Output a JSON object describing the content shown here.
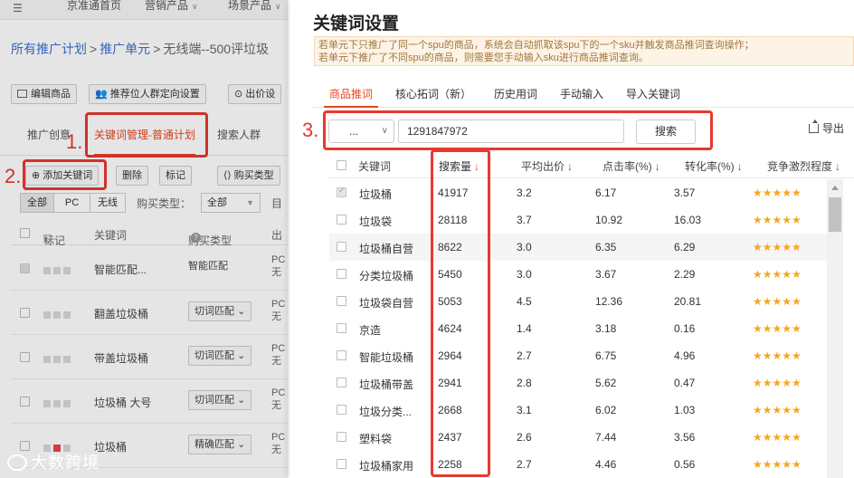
{
  "background": {
    "topnav": {
      "menu_icon": "menu-icon",
      "items": [
        "京准通首页",
        "营销产品",
        "场景产品"
      ]
    },
    "breadcrumb": {
      "part1": "所有推广计划",
      "part2": "推广单元",
      "part3": "无线端--500评垃圾"
    },
    "toolbar1": {
      "edit_goods": "编辑商品",
      "recommend_crowd": "推荐位人群定向设置",
      "bid": "出价设"
    },
    "tabs": {
      "creative": "推广创意",
      "keywords": "关键词管理-普通计划",
      "crowd": "搜索人群"
    },
    "toolbar2": {
      "add_keyword": "添加关键词",
      "delete": "删除",
      "mark": "标记",
      "buy_type": "购买类型"
    },
    "filter": {
      "all": "全部",
      "pc": "PC",
      "wireless": "无线",
      "buy_type_label": "购买类型：",
      "buy_type_value": "全部",
      "extra": "目"
    },
    "table_headers": {
      "mark": "标记",
      "keyword": "关键词",
      "buy_type": "购买类型",
      "more": "出"
    },
    "rows": [
      {
        "keyword": "智能匹配...",
        "buy_type": "智能匹配",
        "plain": true,
        "pc": "PC",
        "wl": "无",
        "red": false
      },
      {
        "keyword": "翻盖垃圾桶",
        "buy_type": "切词匹配",
        "plain": false,
        "pc": "PC",
        "wl": "无",
        "red": false
      },
      {
        "keyword": "带盖垃圾桶",
        "buy_type": "切词匹配",
        "plain": false,
        "pc": "PC",
        "wl": "无",
        "red": false
      },
      {
        "keyword": "垃圾桶 大号",
        "buy_type": "切词匹配",
        "plain": false,
        "pc": "PC",
        "wl": "无",
        "red": false
      },
      {
        "keyword": "垃圾桶",
        "buy_type": "精确匹配",
        "plain": false,
        "pc": "PC",
        "wl": "无",
        "red": true
      }
    ],
    "annotations": {
      "n1": "1.",
      "n2": "2.",
      "n3": "3."
    },
    "watermark": "大数跨境"
  },
  "modal": {
    "title": "关键词设置",
    "notice_line1": "若单元下只推广了同一个spu的商品，系统会自动抓取该spu下的一个sku并触发商品推词查询操作；",
    "notice_line2": "若单元下推广了不同spu的商品，则需要您手动输入sku进行商品推词查询。",
    "tabs": [
      "商品推词",
      "核心拓词（新）",
      "历史用词",
      "手动输入",
      "导入关键词"
    ],
    "select_value": "...",
    "sku_input": "1291847972",
    "search_button": "搜索",
    "export_label": "导出",
    "columns": {
      "keyword": "关键词",
      "search_volume": "搜索量",
      "avg_bid": "平均出价",
      "ctr": "点击率(%)",
      "cvr": "转化率(%)",
      "competition": "竞争激烈程度"
    },
    "rows": [
      {
        "keyword": "垃圾桶",
        "volume": "41917",
        "bid": "3.2",
        "ctr": "6.17",
        "cvr": "3.57",
        "stars": "★★★★★",
        "disabled": true
      },
      {
        "keyword": "垃圾袋",
        "volume": "28118",
        "bid": "3.7",
        "ctr": "10.92",
        "cvr": "16.03",
        "stars": "★★★★★",
        "disabled": false
      },
      {
        "keyword": "垃圾桶自营",
        "volume": "8622",
        "bid": "3.0",
        "ctr": "6.35",
        "cvr": "6.29",
        "stars": "★★★★★",
        "disabled": false
      },
      {
        "keyword": "分类垃圾桶",
        "volume": "5450",
        "bid": "3.0",
        "ctr": "3.67",
        "cvr": "2.29",
        "stars": "★★★★★",
        "disabled": false
      },
      {
        "keyword": "垃圾袋自营",
        "volume": "5053",
        "bid": "4.5",
        "ctr": "12.36",
        "cvr": "20.81",
        "stars": "★★★★★",
        "disabled": false
      },
      {
        "keyword": "京造",
        "volume": "4624",
        "bid": "1.4",
        "ctr": "3.18",
        "cvr": "0.16",
        "stars": "★★★★★",
        "disabled": false
      },
      {
        "keyword": "智能垃圾桶",
        "volume": "2964",
        "bid": "2.7",
        "ctr": "6.75",
        "cvr": "4.96",
        "stars": "★★★★★",
        "disabled": false
      },
      {
        "keyword": "垃圾桶带盖",
        "volume": "2941",
        "bid": "2.8",
        "ctr": "5.62",
        "cvr": "0.47",
        "stars": "★★★★★",
        "disabled": false
      },
      {
        "keyword": "垃圾分类...",
        "volume": "2668",
        "bid": "3.1",
        "ctr": "6.02",
        "cvr": "1.03",
        "stars": "★★★★★",
        "disabled": false
      },
      {
        "keyword": "塑料袋",
        "volume": "2437",
        "bid": "2.6",
        "ctr": "7.44",
        "cvr": "3.56",
        "stars": "★★★★★",
        "disabled": false
      },
      {
        "keyword": "垃圾桶家用",
        "volume": "2258",
        "bid": "2.7",
        "ctr": "4.46",
        "cvr": "0.56",
        "stars": "★★★★★",
        "disabled": false
      }
    ]
  },
  "colors": {
    "accent": "#e9451f",
    "annotation": "#e8382f",
    "link": "#3b6fd4",
    "star": "#f5a623"
  }
}
